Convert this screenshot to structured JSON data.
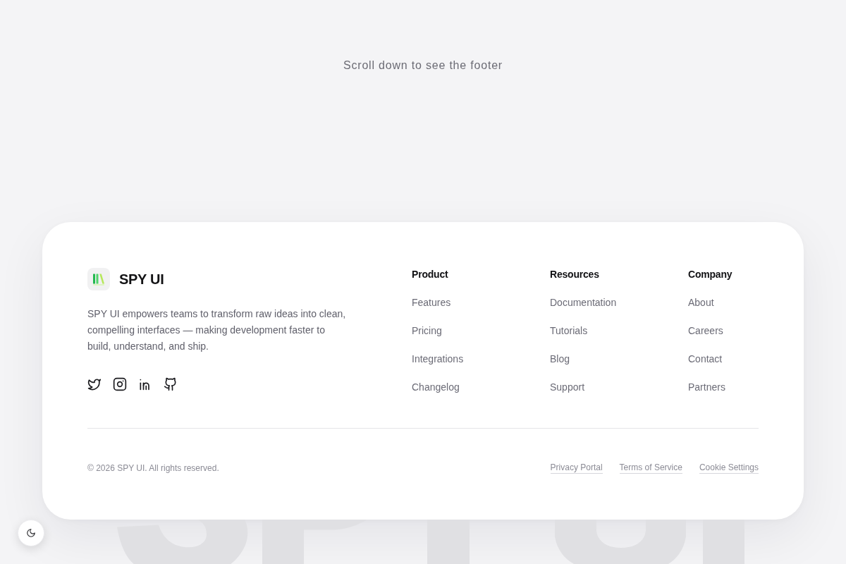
{
  "page": {
    "hint": "Scroll down to see the footer"
  },
  "footer": {
    "brand": {
      "name": "SPY UI",
      "description": "SPY UI empowers teams to transform raw ideas into clean, compelling interfaces — making development faster to build, understand, and ship."
    },
    "social_links": [
      {
        "kind": "twitter"
      },
      {
        "kind": "instagram"
      },
      {
        "kind": "linkedin"
      },
      {
        "kind": "github"
      }
    ],
    "columns": [
      {
        "title": "Product",
        "links": [
          "Features",
          "Pricing",
          "Integrations",
          "Changelog"
        ]
      },
      {
        "title": "Resources",
        "links": [
          "Documentation",
          "Tutorials",
          "Blog",
          "Support"
        ]
      },
      {
        "title": "Company",
        "links": [
          "About",
          "Careers",
          "Contact",
          "Partners"
        ]
      }
    ],
    "copyright": "© 2026 SPY UI. All rights reserved.",
    "legal_links": [
      "Privacy Portal",
      "Terms of Service",
      "Cookie Settings"
    ]
  }
}
